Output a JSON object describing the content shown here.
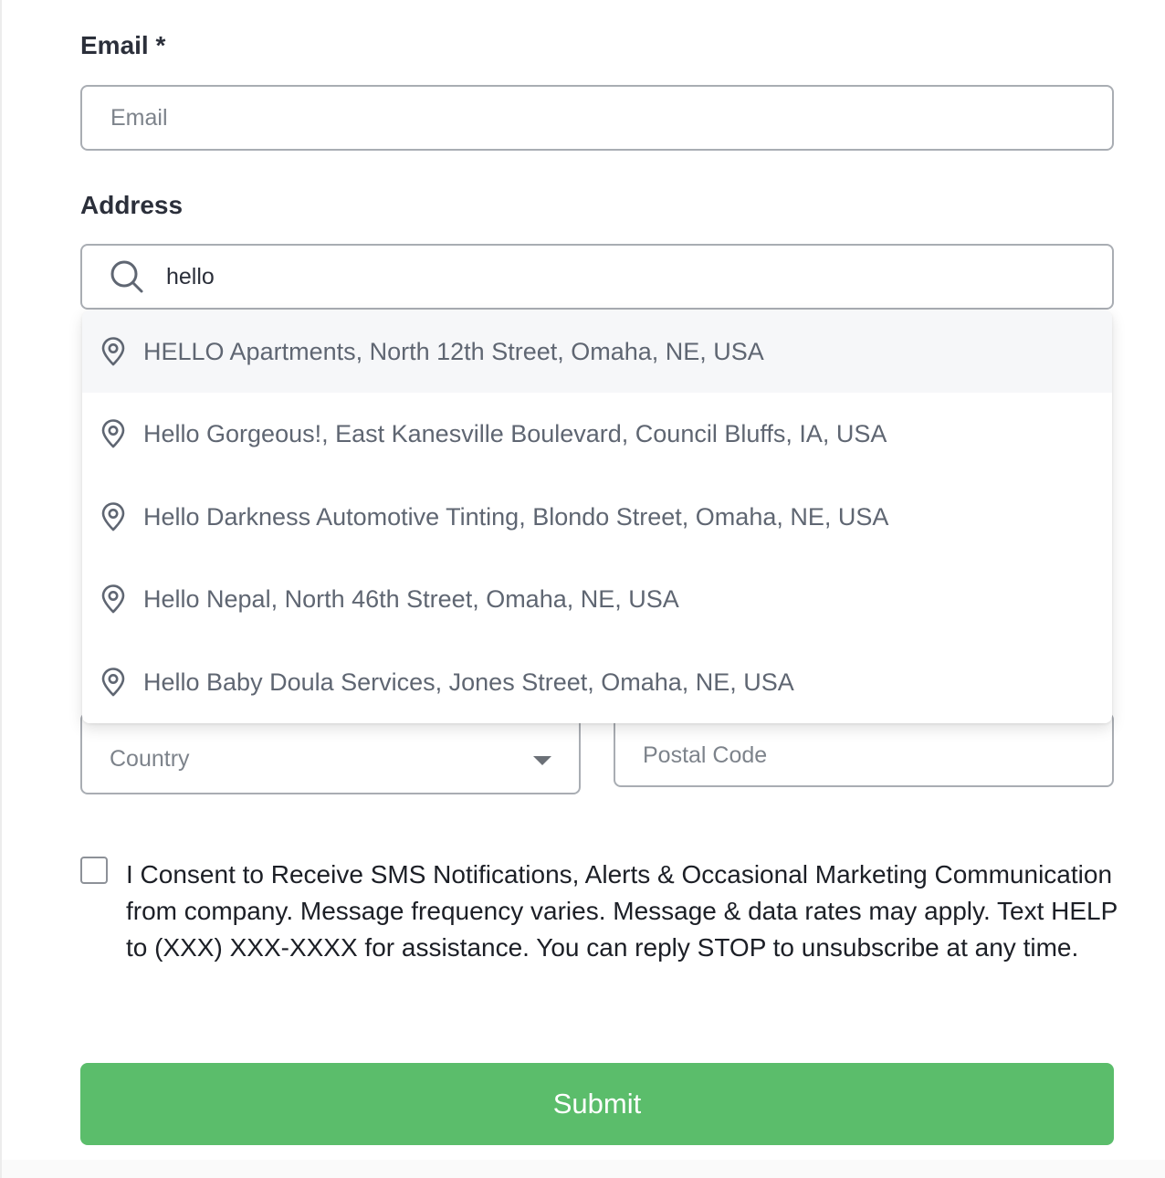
{
  "form": {
    "email": {
      "label": "Email *",
      "placeholder": "Email",
      "value": ""
    },
    "address": {
      "label": "Address",
      "value": "hello",
      "suggestions": [
        "HELLO Apartments, North 12th Street, Omaha, NE, USA",
        "Hello Gorgeous!, East Kanesville Boulevard, Council Bluffs, IA, USA",
        "Hello Darkness Automotive Tinting, Blondo Street, Omaha, NE, USA",
        "Hello Nepal, North 46th Street, Omaha, NE, USA",
        "Hello Baby Doula Services, Jones Street, Omaha, NE, USA"
      ]
    },
    "country": {
      "placeholder": "Country"
    },
    "postal_code": {
      "placeholder": "Postal Code"
    },
    "consent": {
      "checked": false,
      "text": "I Consent to Receive SMS Notifications, Alerts & Occasional Marketing Communication from company. Message frequency varies. Message & data rates may apply. Text HELP to (XXX) XXX-XXXX for assistance. You can reply STOP to unsubscribe at any time."
    },
    "submit_label": "Submit"
  },
  "icons": {
    "search": "search-icon",
    "location": "map-pin-icon",
    "dropdown": "chevron-down-icon"
  },
  "colors": {
    "submit": "#5bbd6b",
    "field_border": "#a9adb3",
    "suggestion_text": "#5f6672",
    "active_suggestion_bg": "#f6f7f9"
  }
}
